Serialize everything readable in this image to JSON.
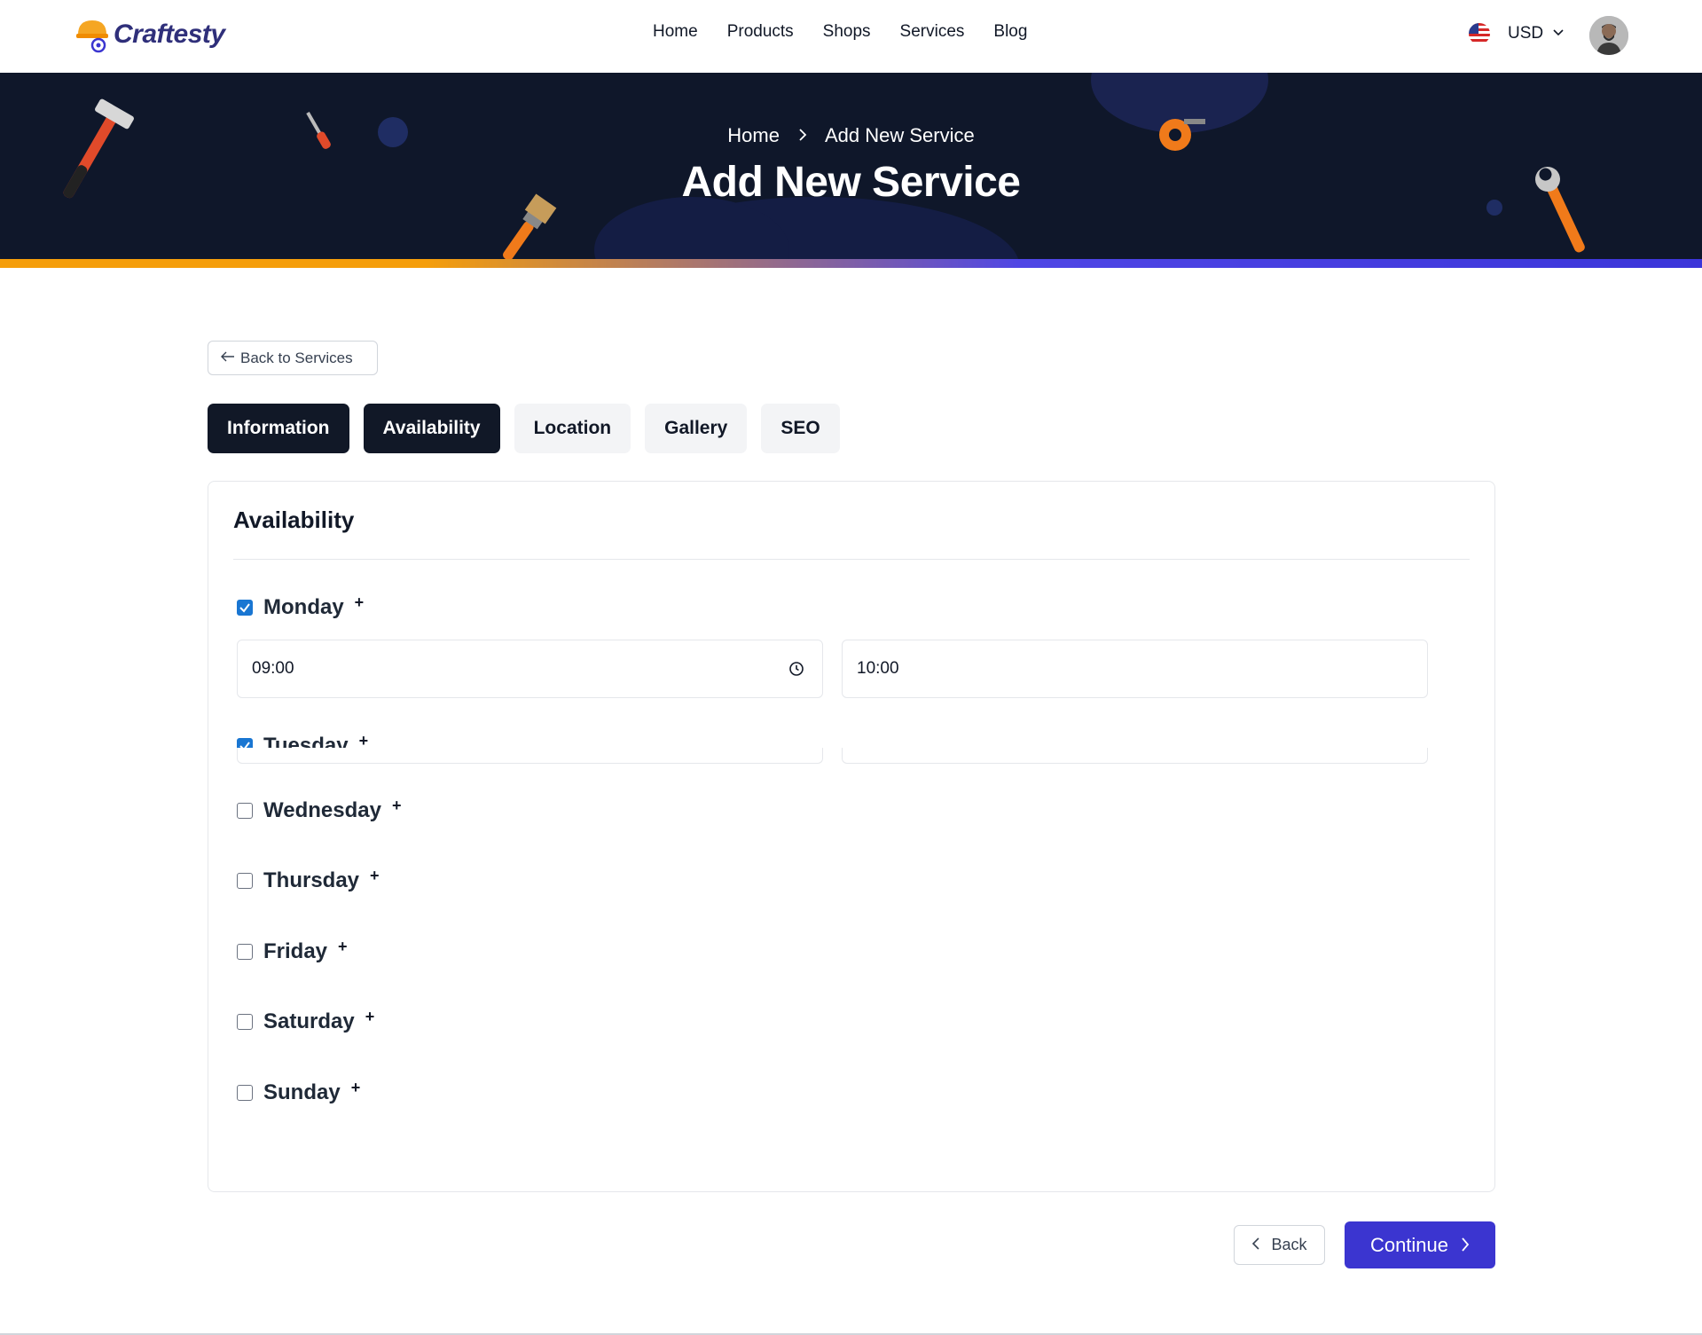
{
  "header": {
    "logo_text": "Craftesty",
    "nav": [
      "Home",
      "Products",
      "Shops",
      "Services",
      "Blog"
    ],
    "currency": "USD"
  },
  "hero": {
    "breadcrumb_home": "Home",
    "breadcrumb_current": "Add New Service",
    "title": "Add New Service"
  },
  "back_link": "Back to Services",
  "tabs": [
    {
      "label": "Information",
      "active": true
    },
    {
      "label": "Availability",
      "active": true
    },
    {
      "label": "Location",
      "active": false
    },
    {
      "label": "Gallery",
      "active": false
    },
    {
      "label": "SEO",
      "active": false
    }
  ],
  "card": {
    "title": "Availability",
    "days": [
      {
        "label": "Monday",
        "checked": true,
        "from": "09:00",
        "to": "10:00"
      },
      {
        "label": "Tuesday",
        "checked": true
      },
      {
        "label": "Wednesday",
        "checked": false
      },
      {
        "label": "Thursday",
        "checked": false
      },
      {
        "label": "Friday",
        "checked": false
      },
      {
        "label": "Saturday",
        "checked": false
      },
      {
        "label": "Sunday",
        "checked": false
      }
    ],
    "plus_symbol": "+"
  },
  "buttons": {
    "back": "Back",
    "continue": "Continue"
  },
  "colors": {
    "primary": "#3b35d0",
    "dark": "#111827",
    "hero_bg": "#0f172a",
    "accent_orange": "#f59e0b",
    "checkbox": "#1976d2"
  }
}
